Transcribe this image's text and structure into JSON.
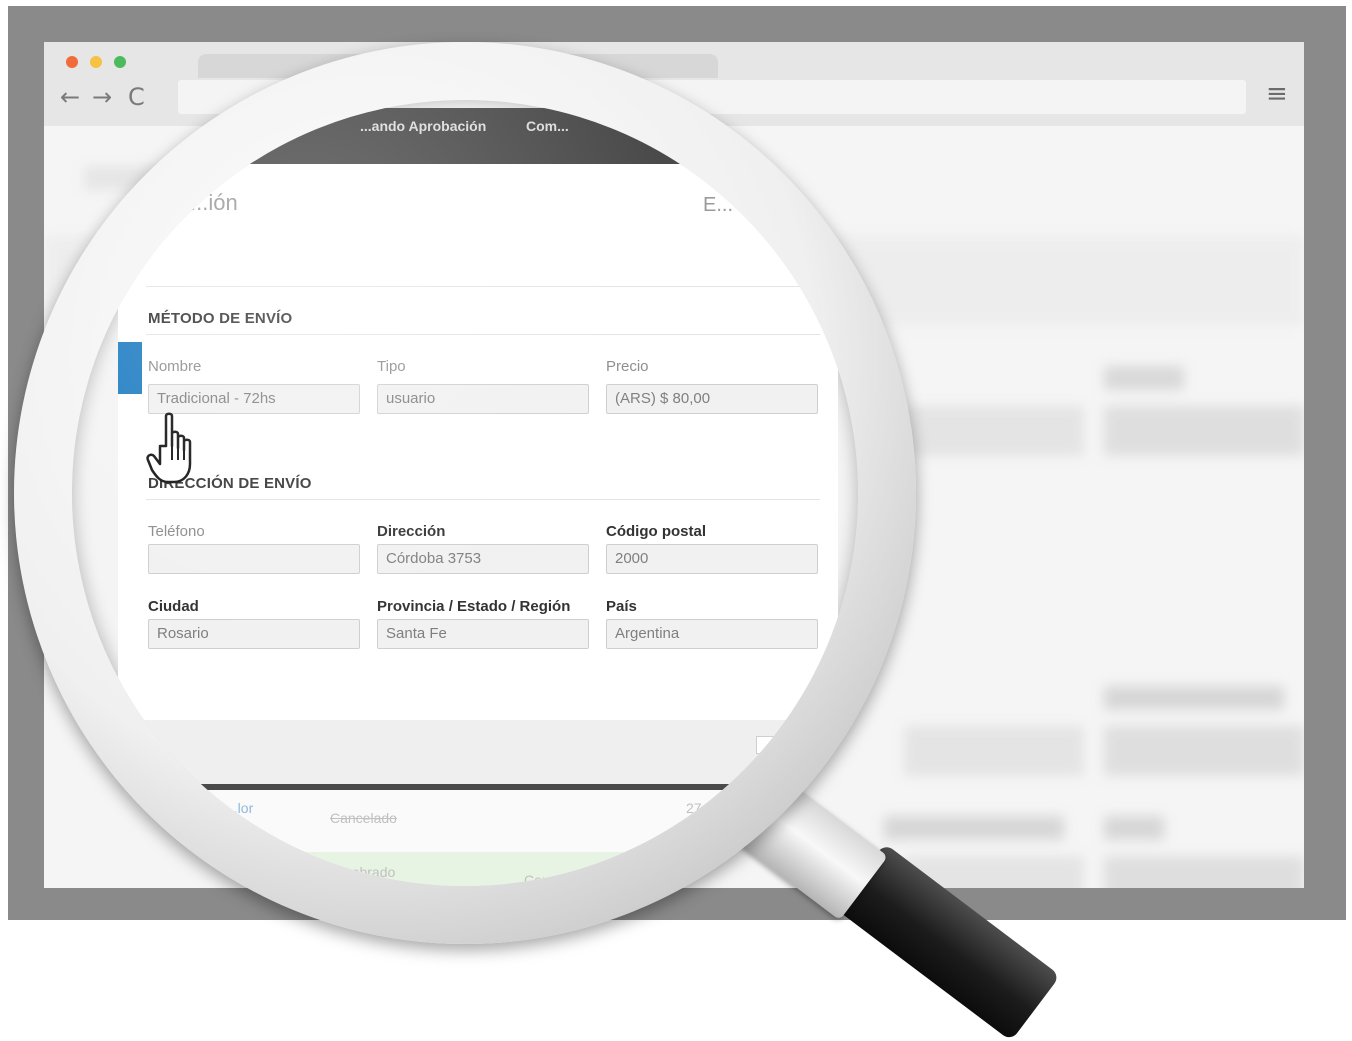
{
  "browser": {
    "nav": {
      "back_icon": "←",
      "forward_icon": "→",
      "reload_icon": "C",
      "menu_icon": "≡"
    }
  },
  "topbar": {
    "item_1": "...ando Aprobación",
    "item_2": "Com..."
  },
  "panel": {
    "heading_fragment": "...ión",
    "heading_right_fragment": "E..."
  },
  "shipping_method": {
    "title": "MÉTODO DE ENVÍO",
    "fields": [
      {
        "label": "Nombre",
        "value": "Tradicional - 72hs"
      },
      {
        "label": "Tipo",
        "value": "usuario"
      },
      {
        "label": "Precio",
        "value": "(ARS) $ 80,00"
      }
    ]
  },
  "shipping_address": {
    "title": "DIRECCIÓN DE ENVÍO",
    "fields": [
      {
        "label": "Teléfono",
        "value": ""
      },
      {
        "label": "Dirección",
        "value": "Córdoba 3753"
      },
      {
        "label": "Código postal",
        "value": "2000"
      },
      {
        "label": "Ciudad",
        "value": "Rosario"
      },
      {
        "label": "Provincia / Estado / Región",
        "value": "Santa Fe"
      },
      {
        "label": "País",
        "value": "Argentina"
      }
    ]
  },
  "lower": {
    "link_fragment": "...lor",
    "status_text": "Cancelado",
    "date_fragment": "27...",
    "green_text": "...obrado",
    "green_right": "Con..."
  }
}
